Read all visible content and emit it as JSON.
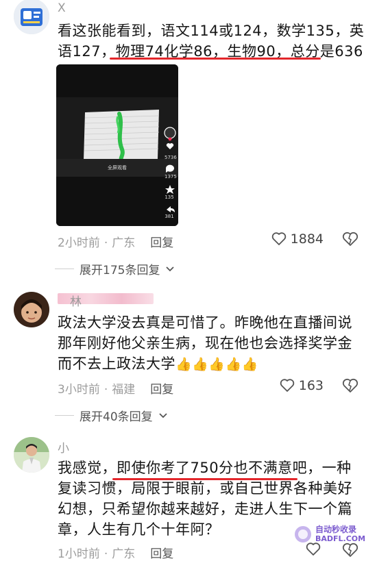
{
  "comments": [
    {
      "username": "X",
      "text_pre": "看这张能看到，语文114或124，数学135，英语127，",
      "text_highlight": "物理74化学86，生物90，总分是636",
      "time": "2小时前",
      "location": "广东",
      "reply_label": "回复",
      "likes": "1884",
      "expand_label": "展开175条回复",
      "video": {
        "like_count": "5736",
        "comment_count": "1375",
        "fav_count": "135",
        "share_count": "381",
        "fullscreen_label": "全屏观看"
      }
    },
    {
      "username": "林",
      "text": "政法大学没去真是可惜了。昨晚他在直播间说那年刚好他父亲生病，现在他也会选择奖学金而不去上政法大学",
      "emojis": "👍👍👍👍👍",
      "time": "3小时前",
      "location": "福建",
      "reply_label": "回复",
      "likes": "163",
      "expand_label": "展开40条回复"
    },
    {
      "username": "小",
      "text_pre": "我感觉，",
      "text_highlight": "即使你考了750分也不满意吧",
      "text_post": "，一种复读习惯，局限于眼前，或自己世界各种美好幻想，只希望你越来越好，走进人生下一个篇章，人生有几个十年阿？",
      "time": "1小时前",
      "location": "广东",
      "reply_label": "回复"
    }
  ],
  "watermark": {
    "line1": "自动秒收录",
    "line2": "BADFL.COM"
  },
  "colors": {
    "highlight_line": "#e3262b",
    "meta_text": "#9c9c9c",
    "body_text": "#161616"
  }
}
